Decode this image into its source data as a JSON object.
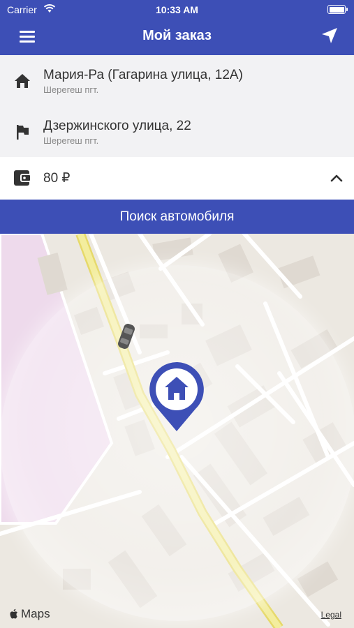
{
  "status_bar": {
    "carrier": "Carrier",
    "time": "10:33 AM"
  },
  "header": {
    "title": "Мой заказ",
    "menu_icon": "hamburger-icon",
    "location_icon": "navigation-arrow-icon"
  },
  "pickup": {
    "name": "Мария-Ра (Гагарина улица, 12А)",
    "locality": "Шерегеш пгт.",
    "icon": "home-icon"
  },
  "destination": {
    "name": "Дзержинского улица, 22",
    "locality": "Шерегеш пгт.",
    "icon": "flag-icon"
  },
  "price": {
    "value": "80 ₽",
    "icon": "wallet-icon",
    "toggle_icon": "chevron-up-icon"
  },
  "search_button": {
    "label": "Поиск автомобиля"
  },
  "map": {
    "provider_label": "Maps",
    "legal_label": "Legal",
    "pin_icon": "home-icon",
    "accent": "#3d4fb6"
  },
  "colors": {
    "primary": "#3d4fb6",
    "background": "#f2f2f4",
    "text": "#333333",
    "secondary_text": "#888888"
  }
}
